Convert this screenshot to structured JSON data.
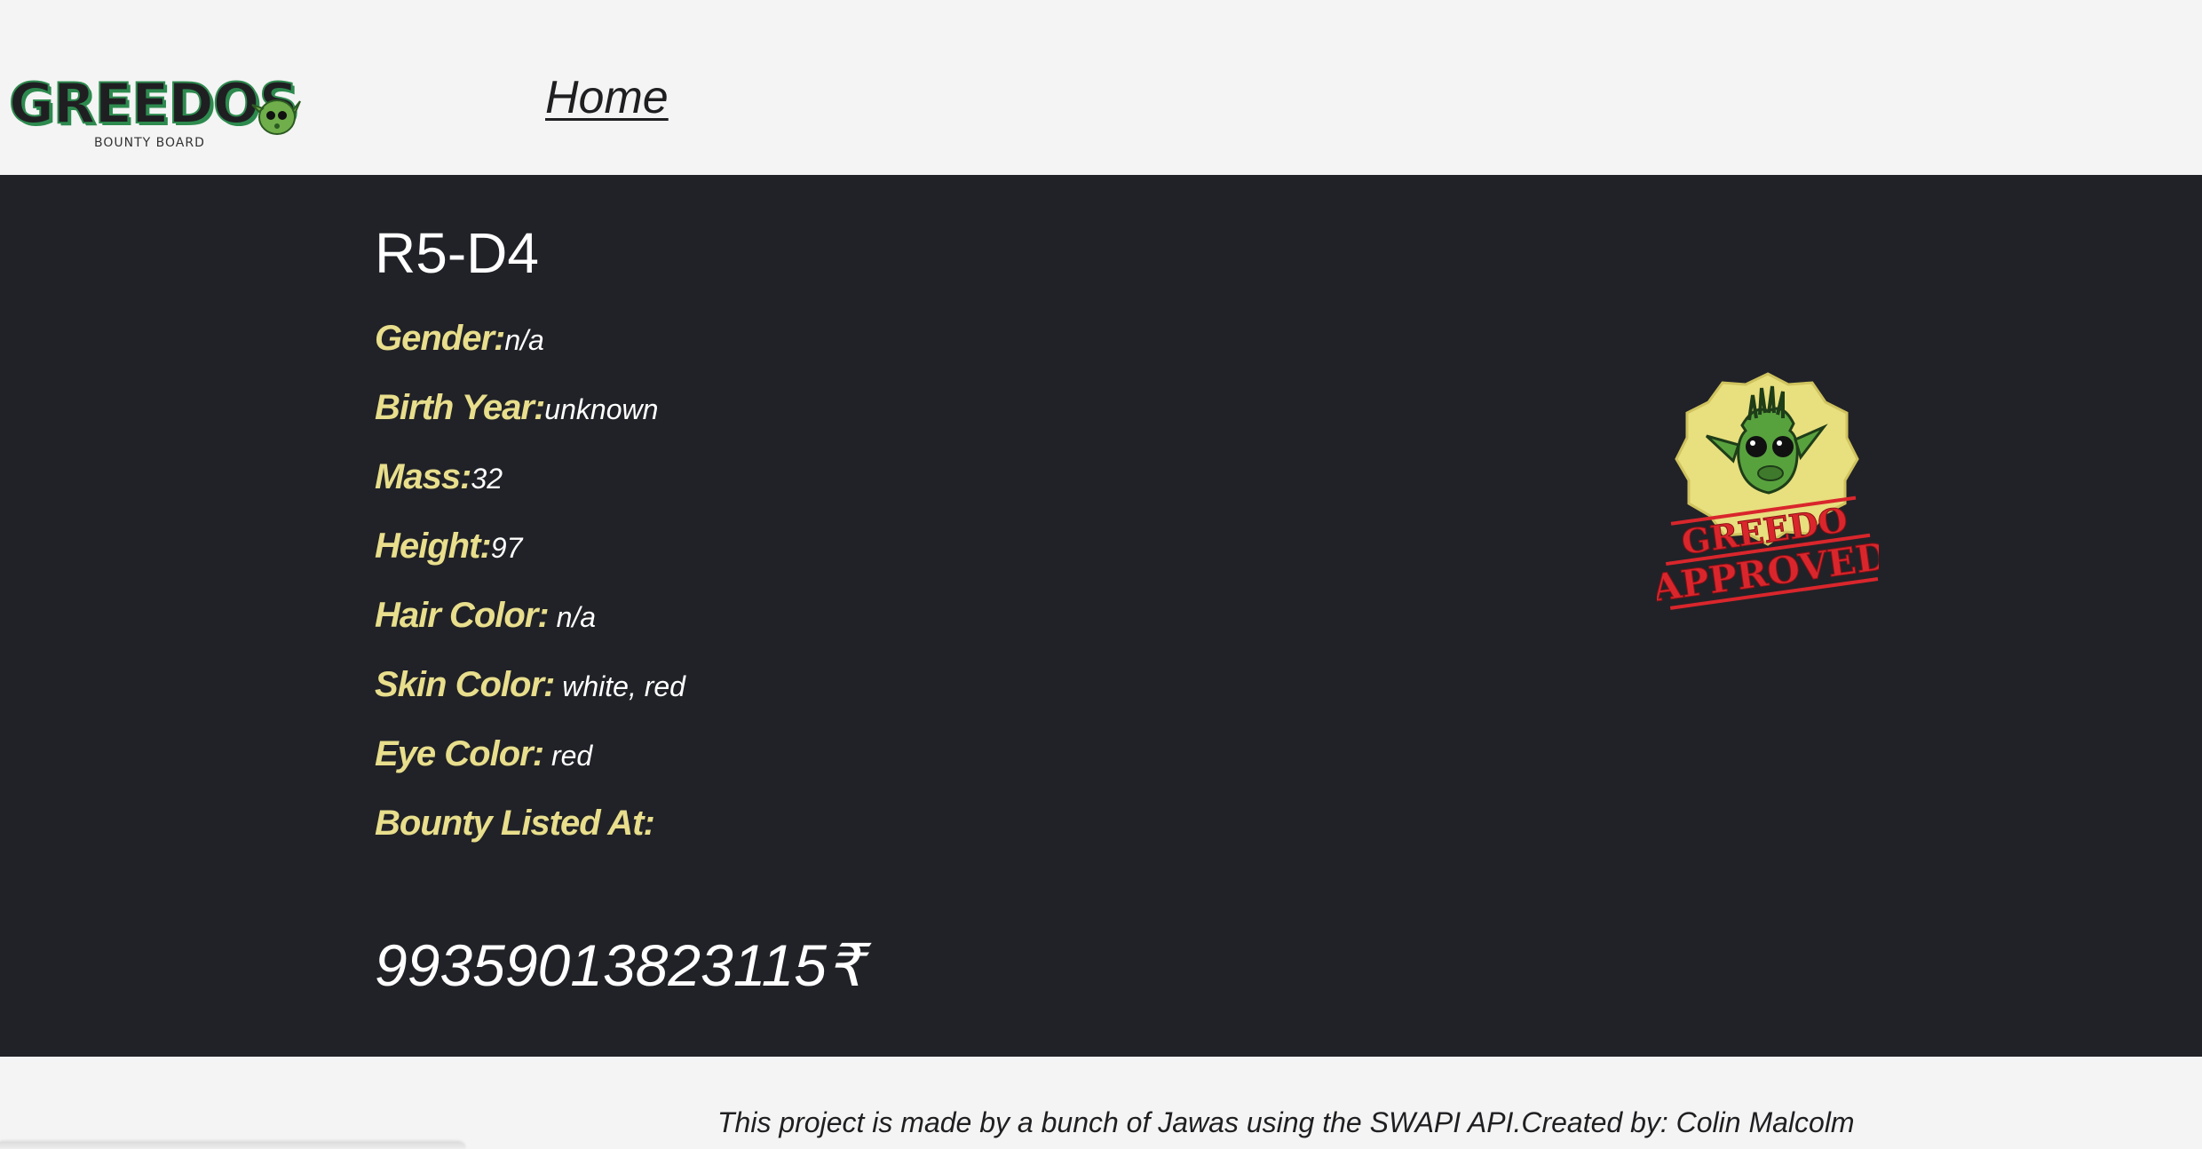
{
  "header": {
    "logo_text": "GREEDOS",
    "logo_subtitle": "BOUNTY BOARD",
    "nav_home": "Home"
  },
  "character": {
    "name": "R5-D4",
    "attributes": [
      {
        "label": "Gender:",
        "value": "n/a"
      },
      {
        "label": "Birth Year:",
        "value": "unknown"
      },
      {
        "label": "Mass:",
        "value": "32"
      },
      {
        "label": "Height:",
        "value": "97"
      },
      {
        "label": "Hair Color:",
        "value": " n/a"
      },
      {
        "label": "Skin Color:",
        "value": " white, red"
      },
      {
        "label": "Eye Color:",
        "value": " red"
      },
      {
        "label": "Bounty Listed At:",
        "value": ""
      }
    ],
    "bounty_amount": "99359013823115₹"
  },
  "stamp": {
    "line1": "GREEDO",
    "line2": "APPROVED",
    "colors": {
      "seal": "#e8df7e",
      "ink": "#d9262c",
      "creature": "#4e9a3c"
    }
  },
  "footer": {
    "text": "This project is made by a bunch of Jawas using the SWAPI API.Created by: Colin Malcolm"
  },
  "colors": {
    "background_dark": "#212227",
    "background_light": "#f4f4f4",
    "label_accent": "#e8de8c",
    "text_light": "#ffffff"
  }
}
